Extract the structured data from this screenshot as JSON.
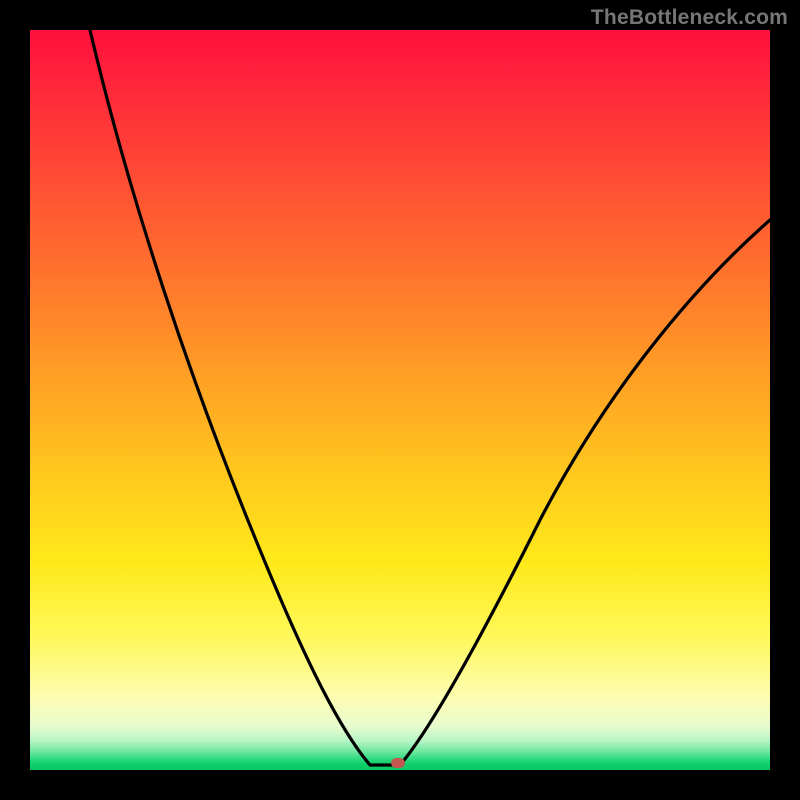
{
  "watermark": "TheBottleneck.com",
  "marker": {
    "x_pct": 49.7,
    "y_pct": 99.0,
    "color": "#c0594e"
  },
  "chart_data": {
    "type": "line",
    "title": "",
    "xlabel": "",
    "ylabel": "",
    "xlim": [
      0,
      100
    ],
    "ylim": [
      0,
      100
    ],
    "grid": false,
    "legend": false,
    "series": [
      {
        "name": "left-branch",
        "x": [
          8,
          11,
          14,
          17,
          20,
          23,
          26,
          29,
          32,
          35,
          38,
          41,
          44,
          46,
          47,
          48,
          49
        ],
        "y": [
          100,
          92,
          84,
          76,
          69,
          61,
          54,
          47,
          40,
          33,
          26.5,
          20,
          13,
          7,
          4,
          2,
          0.5
        ]
      },
      {
        "name": "min-flat",
        "x": [
          46,
          50
        ],
        "y": [
          0.5,
          0.5
        ]
      },
      {
        "name": "right-branch",
        "x": [
          50,
          52,
          55,
          58,
          62,
          66,
          70,
          75,
          80,
          85,
          90,
          95,
          100
        ],
        "y": [
          0.5,
          3,
          8,
          14,
          22,
          30,
          38,
          46,
          53,
          59.5,
          65.5,
          70.5,
          75
        ]
      }
    ],
    "background_gradient": {
      "direction": "vertical",
      "stops": [
        {
          "pct": 0,
          "color": "#ff0f3d"
        },
        {
          "pct": 22,
          "color": "#ff5233"
        },
        {
          "pct": 48,
          "color": "#ffa324"
        },
        {
          "pct": 72,
          "color": "#ffe91a"
        },
        {
          "pct": 90,
          "color": "#fdfdb0"
        },
        {
          "pct": 97.5,
          "color": "#6ee7a0"
        },
        {
          "pct": 100,
          "color": "#05c963"
        }
      ]
    },
    "marker_point": {
      "x": 49.7,
      "y": 0.5
    }
  }
}
